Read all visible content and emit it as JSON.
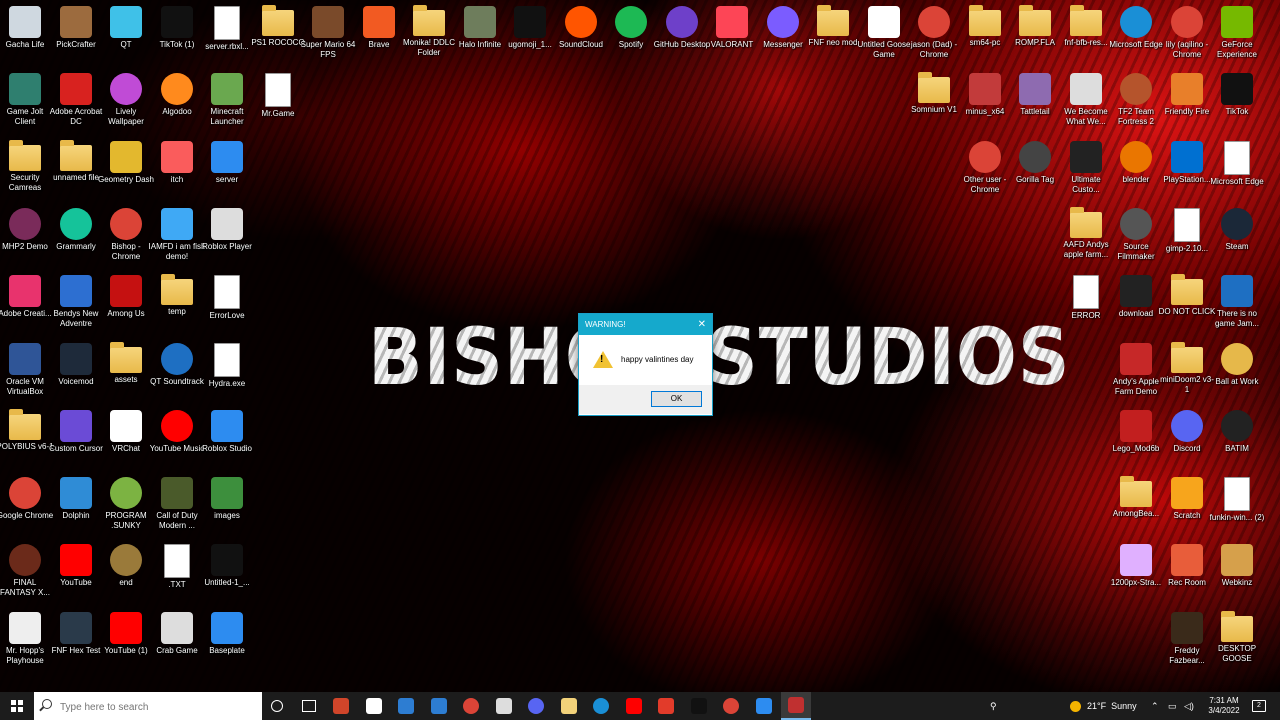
{
  "wallpaper": {
    "text": "BISHOP STUDIOS"
  },
  "desktop_icons_left": [
    {
      "label": "Gacha Life",
      "icon": "bin-icon",
      "color": "#cfd8e0",
      "kind": "plain"
    },
    {
      "label": "PickCrafter",
      "icon": "pickaxe-icon",
      "color": "#9c6b3e",
      "kind": "plain"
    },
    {
      "label": "QT",
      "icon": "qt-icon",
      "color": "#3fc1e8",
      "kind": "plain"
    },
    {
      "label": "TikTok (1)",
      "icon": "tiktok-icon",
      "color": "#111111",
      "kind": "plain"
    },
    {
      "label": "server.rbxl...",
      "icon": "file-icon",
      "color": "#ffffff",
      "kind": "doc"
    },
    {
      "label": "PS1 ROCOCO",
      "icon": "shortcut-icon",
      "color": "#f2d27a",
      "kind": "folder"
    },
    {
      "label": "Super Mario 64 FPS",
      "icon": "goomba-icon",
      "color": "#7a4a2a",
      "kind": "plain"
    },
    {
      "label": "Brave",
      "icon": "brave-icon",
      "color": "#f25a22",
      "kind": "plain"
    },
    {
      "label": "Monika! DDLC Folder",
      "icon": "folder-icon",
      "color": "#f2d27a",
      "kind": "folder"
    },
    {
      "label": "Halo Infinite",
      "icon": "halo-icon",
      "color": "#6e7d5c",
      "kind": "plain"
    },
    {
      "label": "ugomoji_1...",
      "icon": "image-icon",
      "color": "#111111",
      "kind": "plain"
    },
    {
      "label": "SoundCloud",
      "icon": "soundcloud-icon",
      "color": "#ff5500",
      "kind": "round"
    },
    {
      "label": "Spotify",
      "icon": "spotify-icon",
      "color": "#1db954",
      "kind": "round"
    },
    {
      "label": "GitHub Desktop",
      "icon": "github-icon",
      "color": "#6e40c9",
      "kind": "round"
    },
    {
      "label": "VALORANT",
      "icon": "valorant-icon",
      "color": "#fd4556",
      "kind": "plain"
    },
    {
      "label": "Messenger",
      "icon": "messenger-icon",
      "color": "#7b5cff",
      "kind": "round"
    },
    {
      "label": "FNF neo mod",
      "icon": "folder-icon",
      "color": "#f2d27a",
      "kind": "folder"
    },
    {
      "label": "Untitled Goose Game",
      "icon": "goose-icon",
      "color": "#ffffff",
      "kind": "plain"
    },
    {
      "label": "jason (Dad) - Chrome",
      "icon": "chrome-icon",
      "color": "#db4437",
      "kind": "round"
    },
    {
      "label": "sm64-pc",
      "icon": "folder-icon",
      "color": "#f2d27a",
      "kind": "folder"
    },
    {
      "label": "ROMP.FLA",
      "icon": "folder-icon",
      "color": "#f2d27a",
      "kind": "folder"
    },
    {
      "label": "fnf-bfb-res...",
      "icon": "folder-icon",
      "color": "#f2d27a",
      "kind": "folder"
    },
    {
      "label": "Microsoft Edge",
      "icon": "edge-icon",
      "color": "#1a8fd6",
      "kind": "round"
    },
    {
      "label": "lily (aqilino - Chrome",
      "icon": "chrome-icon",
      "color": "#db4437",
      "kind": "round"
    },
    {
      "label": "GeForce Experience",
      "icon": "nvidia-icon",
      "color": "#76b900",
      "kind": "plain"
    },
    {
      "label": "Game Jolt Client",
      "icon": "gamejolt-icon",
      "color": "#2f7f6f",
      "kind": "plain"
    },
    {
      "label": "Adobe Acrobat DC",
      "icon": "acrobat-icon",
      "color": "#d8221f",
      "kind": "plain"
    },
    {
      "label": "Lively Wallpaper",
      "icon": "lively-icon",
      "color": "#c04bd6",
      "kind": "round"
    },
    {
      "label": "Algodoo",
      "icon": "algodoo-icon",
      "color": "#ff8a1d",
      "kind": "round"
    },
    {
      "label": "Minecraft Launcher",
      "icon": "minecraft-icon",
      "color": "#6aa84f",
      "kind": "plain"
    },
    {
      "label": "Mr.Game",
      "icon": "script-icon",
      "color": "#ffffff",
      "kind": "doc"
    },
    {
      "label": "Somnium V1",
      "icon": "folder-icon",
      "color": "#f2d27a",
      "kind": "folder"
    },
    {
      "label": "minus_x64",
      "icon": "image-icon",
      "color": "#c23b3b",
      "kind": "plain"
    },
    {
      "label": "Tattletail",
      "icon": "tattletail-icon",
      "color": "#8e6bb0",
      "kind": "plain"
    },
    {
      "label": "We Become What We...",
      "icon": "wbww-icon",
      "color": "#dddddd",
      "kind": "plain"
    },
    {
      "label": "TF2 Team Fortress 2",
      "icon": "tf2-icon",
      "color": "#b5542c",
      "kind": "round"
    },
    {
      "label": "Friendly Fire",
      "icon": "fire-icon",
      "color": "#e87f2a",
      "kind": "plain"
    },
    {
      "label": "TikTok",
      "icon": "tiktok-icon",
      "color": "#111111",
      "kind": "plain"
    },
    {
      "label": "Security Camreas",
      "icon": "folder-icon",
      "color": "#f2d27a",
      "kind": "folder"
    },
    {
      "label": "unnamed file",
      "icon": "folder-icon",
      "color": "#f2d27a",
      "kind": "folder"
    },
    {
      "label": "Geometry Dash",
      "icon": "geometrydash-icon",
      "color": "#e3b82e",
      "kind": "plain"
    },
    {
      "label": "itch",
      "icon": "itch-icon",
      "color": "#fa5c5c",
      "kind": "plain"
    },
    {
      "label": "server",
      "icon": "roblox-studio-icon",
      "color": "#2d8cf0",
      "kind": "plain"
    },
    {
      "label": "Other user - Chrome",
      "icon": "chrome-icon",
      "color": "#db4437",
      "kind": "round"
    },
    {
      "label": "Gorilla Tag",
      "icon": "gorilla-icon",
      "color": "#444444",
      "kind": "round"
    },
    {
      "label": "Ultimate Custo...",
      "icon": "fnaf-icon",
      "color": "#222222",
      "kind": "plain"
    },
    {
      "label": "blender",
      "icon": "blender-icon",
      "color": "#ea7600",
      "kind": "round"
    },
    {
      "label": "PlayStation...",
      "icon": "playstation-icon",
      "color": "#0070d1",
      "kind": "plain"
    },
    {
      "label": "Microsoft Edge",
      "icon": "file-icon",
      "color": "#ffffff",
      "kind": "doc"
    },
    {
      "label": "MHP2 Demo",
      "icon": "mhp-icon",
      "color": "#7a2b5a",
      "kind": "round"
    },
    {
      "label": "Grammarly",
      "icon": "grammarly-icon",
      "color": "#15c39a",
      "kind": "round"
    },
    {
      "label": "Bishop - Chrome",
      "icon": "chrome-icon",
      "color": "#db4437",
      "kind": "round"
    },
    {
      "label": "IAMFD i am fish demo!",
      "icon": "fish-icon",
      "color": "#3fa9f5",
      "kind": "plain"
    },
    {
      "label": "Roblox Player",
      "icon": "roblox-icon",
      "color": "#dddddd",
      "kind": "plain"
    },
    {
      "label": "AAFD Andys apple farm...",
      "icon": "folder-icon",
      "color": "#f2d27a",
      "kind": "folder"
    },
    {
      "label": "Source Filmmaker",
      "icon": "sfm-icon",
      "color": "#555555",
      "kind": "round"
    },
    {
      "label": "gimp-2.10...",
      "icon": "file-icon",
      "color": "#ffffff",
      "kind": "doc"
    },
    {
      "label": "Steam",
      "icon": "steam-icon",
      "color": "#1b2838",
      "kind": "round"
    },
    {
      "label": "Adobe Creati...",
      "icon": "creative-cloud-icon",
      "color": "#e8336d",
      "kind": "plain"
    },
    {
      "label": "Bendys New Adventre",
      "icon": "bendy-icon",
      "color": "#2d6fd1",
      "kind": "plain"
    },
    {
      "label": "Among Us",
      "icon": "amongus-icon",
      "color": "#c51111",
      "kind": "plain"
    },
    {
      "label": "temp",
      "icon": "folder-icon",
      "color": "#f2d27a",
      "kind": "folder"
    },
    {
      "label": "ErrorLove",
      "icon": "script-icon",
      "color": "#ffffff",
      "kind": "doc"
    },
    {
      "label": "ERROR",
      "icon": "script-icon",
      "color": "#ffffff",
      "kind": "doc"
    },
    {
      "label": "download",
      "icon": "image-icon",
      "color": "#222222",
      "kind": "plain"
    },
    {
      "label": "DO NOT CLICK",
      "icon": "folder-icon",
      "color": "#f2d27a",
      "kind": "folder"
    },
    {
      "label": "There is no game Jam...",
      "icon": "x-icon",
      "color": "#1e6fc2",
      "kind": "plain"
    },
    {
      "label": "Oracle VM VirtualBox",
      "icon": "virtualbox-icon",
      "color": "#2f5597",
      "kind": "plain"
    },
    {
      "label": "Voicemod",
      "icon": "voicemod-icon",
      "color": "#1e2a3a",
      "kind": "plain"
    },
    {
      "label": "assets",
      "icon": "folder-icon",
      "color": "#f2d27a",
      "kind": "folder"
    },
    {
      "label": "QT Soundtrack",
      "icon": "music-icon",
      "color": "#1e6fc2",
      "kind": "round"
    },
    {
      "label": "Hydra.exe",
      "icon": "script-icon",
      "color": "#ffffff",
      "kind": "doc"
    },
    {
      "label": "Andy's Apple Farm Demo",
      "icon": "apple-farm-icon",
      "color": "#c62828",
      "kind": "plain"
    },
    {
      "label": "miniDoom2 v3-1",
      "icon": "folder-icon",
      "color": "#f2d27a",
      "kind": "folder"
    },
    {
      "label": "Ball at Work",
      "icon": "ball-icon",
      "color": "#e6b84a",
      "kind": "round"
    },
    {
      "label": "POLYBIUS v6-1",
      "icon": "folder-icon",
      "color": "#f2d27a",
      "kind": "folder"
    },
    {
      "label": "Custom Cursor",
      "icon": "cursor-icon",
      "color": "#6b4bd6",
      "kind": "plain"
    },
    {
      "label": "VRChat",
      "icon": "vrchat-icon",
      "color": "#ffffff",
      "kind": "plain"
    },
    {
      "label": "YouTube Music",
      "icon": "youtube-music-icon",
      "color": "#ff0000",
      "kind": "round"
    },
    {
      "label": "Roblox Studio",
      "icon": "roblox-studio-icon",
      "color": "#2d8cf0",
      "kind": "plain"
    },
    {
      "label": "Lego_Mod6b",
      "icon": "lego-icon",
      "color": "#c21f1f",
      "kind": "plain"
    },
    {
      "label": "Discord",
      "icon": "discord-icon",
      "color": "#5865f2",
      "kind": "round"
    },
    {
      "label": "BATIM",
      "icon": "batim-icon",
      "color": "#222222",
      "kind": "round"
    },
    {
      "label": "Google Chrome",
      "icon": "chrome-icon",
      "color": "#db4437",
      "kind": "round"
    },
    {
      "label": "Dolphin",
      "icon": "dolphin-icon",
      "color": "#2f8cd6",
      "kind": "plain"
    },
    {
      "label": "PROGRAM .SUNKY",
      "icon": "sunky-icon",
      "color": "#7cb342",
      "kind": "round"
    },
    {
      "label": "Call of Duty Modern ...",
      "icon": "cod-icon",
      "color": "#4a5a2a",
      "kind": "plain"
    },
    {
      "label": "images",
      "icon": "creeper-icon",
      "color": "#3d8f3d",
      "kind": "plain"
    },
    {
      "label": "AmongBea...",
      "icon": "folder-icon",
      "color": "#f2d27a",
      "kind": "folder"
    },
    {
      "label": "Scratch",
      "icon": "scratch-icon",
      "color": "#f7a51c",
      "kind": "plain"
    },
    {
      "label": "funkin-win... (2)",
      "icon": "file-icon",
      "color": "#ffffff",
      "kind": "doc"
    },
    {
      "label": "FINAL FANTASY X...",
      "icon": "ff-icon",
      "color": "#6b2a1a",
      "kind": "round"
    },
    {
      "label": "YouTube",
      "icon": "youtube-icon",
      "color": "#ff0000",
      "kind": "plain"
    },
    {
      "label": "end",
      "icon": "reel-icon",
      "color": "#9a7a3a",
      "kind": "round"
    },
    {
      "label": ".TXT",
      "icon": "script-icon",
      "color": "#ffffff",
      "kind": "doc"
    },
    {
      "label": "Untitled-1_...",
      "icon": "drawing-icon",
      "color": "#111111",
      "kind": "plain"
    },
    {
      "label": "1200px-Stra...",
      "icon": "flag-icon",
      "color": "#e0b0ff",
      "kind": "plain"
    },
    {
      "label": "Rec Room",
      "icon": "recroom-icon",
      "color": "#e85d3a",
      "kind": "plain"
    },
    {
      "label": "Webkinz",
      "icon": "webkinz-icon",
      "color": "#d6a04b",
      "kind": "plain"
    },
    {
      "label": "Mr. Hopp's Playhouse",
      "icon": "bunny-icon",
      "color": "#eeeeee",
      "kind": "plain"
    },
    {
      "label": "FNF Hex Test",
      "icon": "hex-icon",
      "color": "#2a3a4a",
      "kind": "plain"
    },
    {
      "label": "YouTube (1)",
      "icon": "youtube-icon",
      "color": "#ff0000",
      "kind": "plain"
    },
    {
      "label": "Crab Game",
      "icon": "crab-icon",
      "color": "#dddddd",
      "kind": "plain"
    },
    {
      "label": "Baseplate",
      "icon": "roblox-studio-icon",
      "color": "#2d8cf0",
      "kind": "plain"
    },
    {
      "label": "Freddy Fazbear...",
      "icon": "freddy-icon",
      "color": "#3a2a1a",
      "kind": "plain"
    },
    {
      "label": "DESKTOP GOOSE",
      "icon": "folder-icon",
      "color": "#f2d27a",
      "kind": "folder"
    }
  ],
  "dialog": {
    "title": "WARNING!",
    "close": "✕",
    "message": "happy valintines day",
    "ok_label": "OK"
  },
  "taskbar": {
    "search_placeholder": "Type here to search",
    "weather_temp": "21°F",
    "weather_text": "Sunny",
    "time": "7:31 AM",
    "date": "3/4/2022",
    "notification_count": "2",
    "pinned": [
      {
        "name": "mario-icon",
        "color": "#d0452a"
      },
      {
        "name": "goose-icon",
        "color": "#ffffff"
      },
      {
        "name": "store-icon",
        "color": "#2d7dd2"
      },
      {
        "name": "mail-icon",
        "color": "#2d7dd2"
      },
      {
        "name": "chrome-icon",
        "color": "#db4437"
      },
      {
        "name": "roblox-icon",
        "color": "#dddddd"
      },
      {
        "name": "discord-icon",
        "color": "#5865f2"
      },
      {
        "name": "folder-icon",
        "color": "#f2d27a"
      },
      {
        "name": "edge-icon",
        "color": "#1a8fd6"
      },
      {
        "name": "youtube-icon",
        "color": "#ff0000"
      },
      {
        "name": "cuphead-icon",
        "color": "#e23b2a"
      },
      {
        "name": "tiktok-icon",
        "color": "#111111"
      },
      {
        "name": "chrome-icon",
        "color": "#db4437"
      },
      {
        "name": "roblox-studio-icon",
        "color": "#2d8cf0"
      },
      {
        "name": "game-icon",
        "color": "#c03030"
      }
    ]
  }
}
